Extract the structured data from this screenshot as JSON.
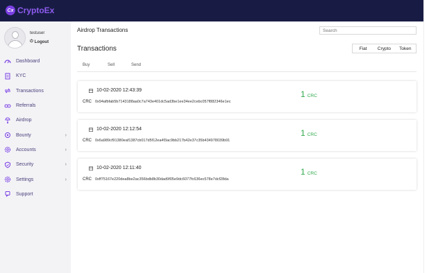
{
  "brand": {
    "mark": "Cx",
    "name": "CryptoEx"
  },
  "user": {
    "name": "testuser",
    "logout_label": "Logout"
  },
  "nav": [
    {
      "label": "Dashboard",
      "icon": "dashboard-icon",
      "chevron": false
    },
    {
      "label": "KYC",
      "icon": "kyc-document-icon",
      "chevron": false
    },
    {
      "label": "Transactions",
      "icon": "transactions-icon",
      "chevron": false
    },
    {
      "label": "Referrals",
      "icon": "referrals-icon",
      "chevron": false
    },
    {
      "label": "Airdrop",
      "icon": "airdrop-icon",
      "chevron": false
    },
    {
      "label": "Bounty",
      "icon": "bounty-icon",
      "chevron": true
    },
    {
      "label": "Accounts",
      "icon": "accounts-gear-icon",
      "chevron": true
    },
    {
      "label": "Security",
      "icon": "security-shield-icon",
      "chevron": true
    },
    {
      "label": "Settings",
      "icon": "settings-gear-icon",
      "chevron": true
    },
    {
      "label": "Support",
      "icon": "support-icon",
      "chevron": false
    }
  ],
  "page": {
    "title": "Airdrop Transactions",
    "search_placeholder": "Search",
    "section_title": "Transactions"
  },
  "filters": [
    "Fiat",
    "Crypto",
    "Token"
  ],
  "subtabs": [
    "Buy",
    "Sell",
    "Send"
  ],
  "transactions": [
    {
      "date": "10-02-2020 12:43:39",
      "currency": "CRC",
      "hash": "0x94afbfab5b7143188aa0c7a743e401dc5ad3be1ee34ee2cebc057f882346e1ec",
      "amount": "1",
      "amount_currency": "CRC"
    },
    {
      "date": "10-02-2020 12:12:54",
      "currency": "CRC",
      "hash": "0x6a989cf91380eaf1387cb017d5f12ea4f3ac9bb217b42e37c35b434978039b91",
      "amount": "1",
      "amount_currency": "CRC"
    },
    {
      "date": "10-02-2020 12:11:40",
      "currency": "CRC",
      "hash": "0xff75167e220dea8be2ac356bdb8b30dad9f05e9dc6077fc636ec578e7dcf28da",
      "amount": "1",
      "amount_currency": "CRC"
    }
  ],
  "colors": {
    "topbar": "#181c44",
    "brand": "#8e5bf0",
    "sidebar": "#f3f3f6",
    "amount": "#2ea84a",
    "nav_icon": "#7b3fe4"
  }
}
